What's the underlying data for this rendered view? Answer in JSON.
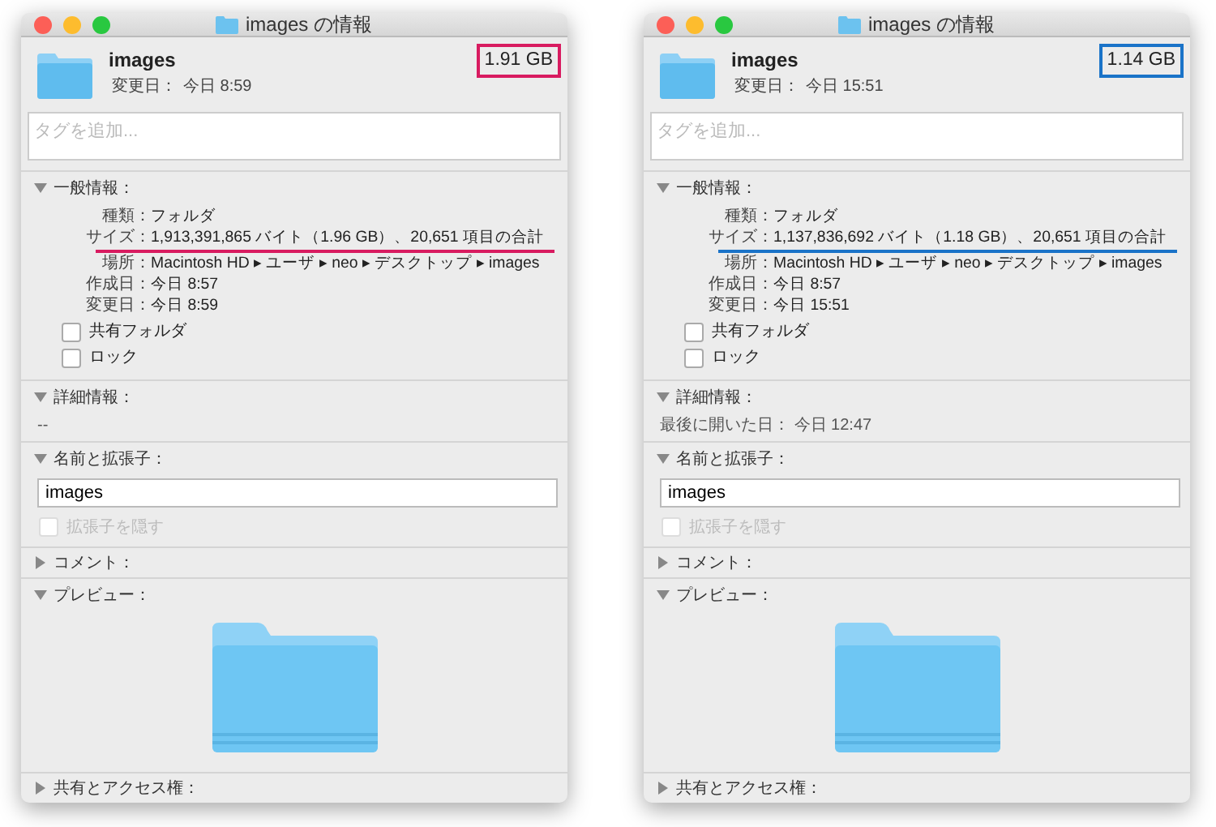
{
  "windows": [
    {
      "title": "images の情報",
      "name": "images",
      "modified_label": "変更日：",
      "modified": "今日 8:59",
      "size": "1.91 GB",
      "color": "#d81b60",
      "tags": {
        "placeholder": "タグを追加..."
      },
      "sections": [
        {
          "kind": "general",
          "label": "一般情報：",
          "expanded": true,
          "rows": [
            {
              "label": "種類：",
              "value": "フォルダ",
              "highlighted": false
            },
            {
              "label": "サイズ：",
              "value": "1,913,391,865 バイト（1.96 GB）、20,651 項目の合計",
              "highlighted": true
            },
            {
              "label": "場所：",
              "value": "Macintosh HD ▸ ユーザ ▸ neo ▸ デスクトップ ▸ images",
              "highlighted": false
            },
            {
              "label": "作成日：",
              "value": "今日 8:57",
              "highlighted": false
            },
            {
              "label": "変更日：",
              "value": "今日 8:59",
              "highlighted": false
            }
          ],
          "checkboxes": [
            {
              "label": "共有フォルダ",
              "checked": false
            },
            {
              "label": "ロック",
              "checked": false
            }
          ]
        },
        {
          "kind": "details",
          "label": "詳細情報：",
          "expanded": true,
          "text": "--"
        },
        {
          "kind": "name",
          "label": "名前と拡張子：",
          "expanded": true,
          "value": "images",
          "hide_extension": {
            "label": "拡張子を隠す",
            "checked": false,
            "disabled": true
          }
        },
        {
          "kind": "comment",
          "label": "コメント：",
          "expanded": false
        },
        {
          "kind": "preview",
          "label": "プレビュー：",
          "expanded": true
        },
        {
          "kind": "sharing",
          "label": "共有とアクセス権：",
          "expanded": false
        }
      ]
    },
    {
      "title": "images の情報",
      "name": "images",
      "modified_label": "変更日：",
      "modified": "今日 15:51",
      "size": "1.14 GB",
      "color": "#1a73c8",
      "tags": {
        "placeholder": "タグを追加..."
      },
      "sections": [
        {
          "kind": "general",
          "label": "一般情報：",
          "expanded": true,
          "rows": [
            {
              "label": "種類：",
              "value": "フォルダ",
              "highlighted": false
            },
            {
              "label": "サイズ：",
              "value": "1,137,836,692 バイト（1.18 GB）、20,651 項目の合計",
              "highlighted": true
            },
            {
              "label": "場所：",
              "value": "Macintosh HD ▸ ユーザ ▸ neo ▸ デスクトップ ▸ images",
              "highlighted": false
            },
            {
              "label": "作成日：",
              "value": "今日 8:57",
              "highlighted": false
            },
            {
              "label": "変更日：",
              "value": "今日 15:51",
              "highlighted": false
            }
          ],
          "checkboxes": [
            {
              "label": "共有フォルダ",
              "checked": false
            },
            {
              "label": "ロック",
              "checked": false
            }
          ]
        },
        {
          "kind": "details",
          "label": "詳細情報：",
          "expanded": true,
          "text": "最後に開いた日： 今日 12:47"
        },
        {
          "kind": "name",
          "label": "名前と拡張子：",
          "expanded": true,
          "value": "images",
          "hide_extension": {
            "label": "拡張子を隠す",
            "checked": false,
            "disabled": true
          }
        },
        {
          "kind": "comment",
          "label": "コメント：",
          "expanded": false
        },
        {
          "kind": "preview",
          "label": "プレビュー：",
          "expanded": true
        },
        {
          "kind": "sharing",
          "label": "共有とアクセス権：",
          "expanded": false
        }
      ]
    }
  ]
}
